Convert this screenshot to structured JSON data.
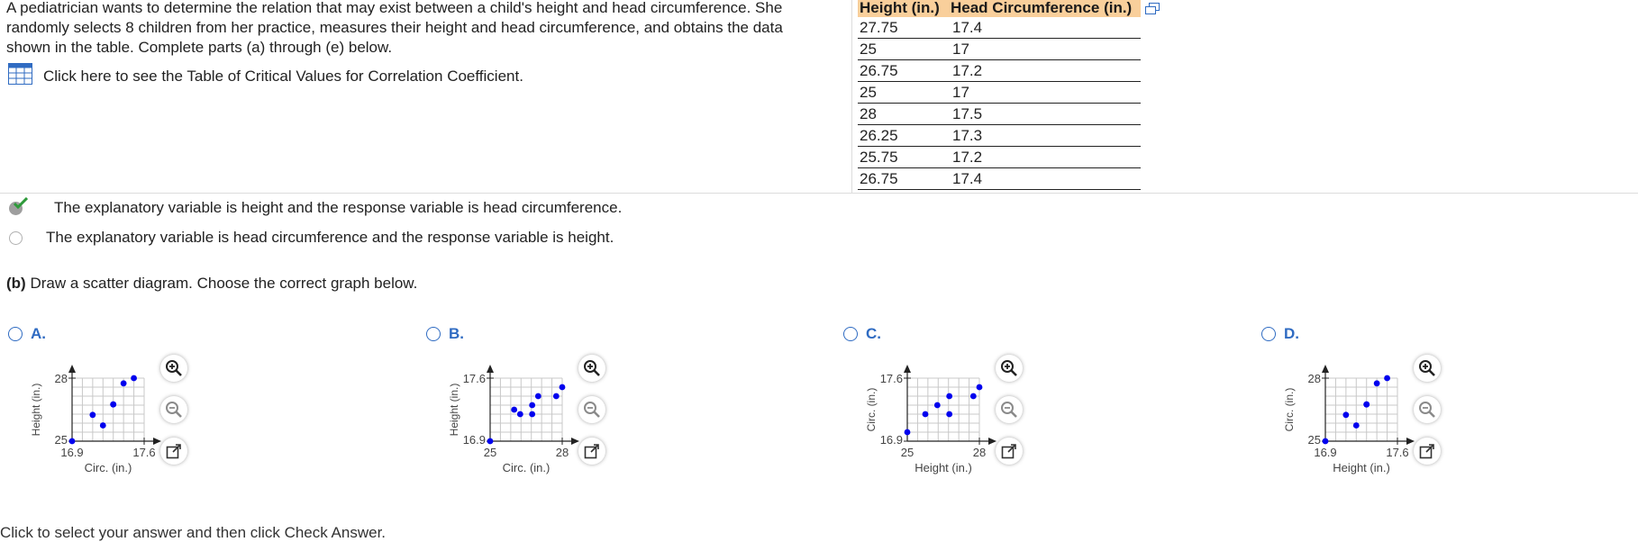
{
  "intro": {
    "line1": "A pediatrician wants to determine the relation that may exist between a child's height and head circumference. She",
    "line2": "randomly selects 8 children from her practice, measures their height and head circumference, and obtains the data",
    "line3": "shown in the table. Complete parts (a) through (e) below."
  },
  "link": {
    "text": "Click here to see the Table of Critical Values for Correlation Coefficient.",
    "icon": "table-grid-icon"
  },
  "table": {
    "headers": [
      "Height (in.)",
      "Head Circumference (in.)"
    ],
    "rows": [
      [
        "27.75",
        "17.4"
      ],
      [
        "25",
        "17"
      ],
      [
        "26.75",
        "17.2"
      ],
      [
        "25",
        "17"
      ],
      [
        "28",
        "17.5"
      ],
      [
        "26.25",
        "17.3"
      ],
      [
        "25.75",
        "17.2"
      ],
      [
        "26.75",
        "17.4"
      ]
    ]
  },
  "options_a": [
    {
      "text": "The explanatory variable is height and the response variable is head circumference.",
      "selected": true
    },
    {
      "text": "The explanatory variable is head circumference and the response variable is height.",
      "selected": false
    }
  ],
  "part_b": {
    "label": "(b)",
    "text": " Draw a scatter diagram. Choose the correct graph below."
  },
  "choices": [
    {
      "letter": "A.",
      "xlabel": "Circ. (in.)",
      "ylabel": "Height (in.)",
      "xticks": [
        "16.9",
        "17.6"
      ],
      "yticks": [
        "25",
        "28"
      ],
      "points": [
        [
          16.9,
          25
        ],
        [
          17.2,
          25.75
        ],
        [
          17.1,
          26.25
        ],
        [
          17.3,
          26.75
        ],
        [
          17.3,
          26.75
        ],
        [
          17.4,
          27.75
        ],
        [
          17.5,
          28
        ]
      ]
    },
    {
      "letter": "B.",
      "xlabel": "Circ. (in.)",
      "ylabel": "Height (in.)",
      "xticks": [
        "25",
        "28"
      ],
      "yticks": [
        "16.9",
        "17.6"
      ],
      "points": [
        [
          25,
          16.9
        ],
        [
          26.25,
          17.2
        ],
        [
          26.75,
          17.3
        ],
        [
          26,
          17.25
        ],
        [
          26.75,
          17.2
        ],
        [
          27,
          17.4
        ],
        [
          27.75,
          17.4
        ],
        [
          28,
          17.5
        ]
      ]
    },
    {
      "letter": "C.",
      "xlabel": "Height (in.)",
      "ylabel": "Circ. (in.)",
      "xticks": [
        "25",
        "28"
      ],
      "yticks": [
        "16.9",
        "17.6"
      ],
      "points": [
        [
          25,
          17
        ],
        [
          25.75,
          17.2
        ],
        [
          26.25,
          17.3
        ],
        [
          26.75,
          17.2
        ],
        [
          26.75,
          17.4
        ],
        [
          27.75,
          17.4
        ],
        [
          28,
          17.5
        ]
      ]
    },
    {
      "letter": "D.",
      "xlabel": "Height (in.)",
      "ylabel": "Circ. (in.)",
      "xticks": [
        "16.9",
        "17.6"
      ],
      "yticks": [
        "25",
        "28"
      ],
      "points": [
        [
          16.9,
          25
        ],
        [
          17.2,
          25.75
        ],
        [
          17.1,
          26.25
        ],
        [
          17.3,
          26.75
        ],
        [
          17.3,
          26.75
        ],
        [
          17.4,
          27.75
        ],
        [
          17.5,
          28
        ]
      ]
    }
  ],
  "tools": {
    "zoom_in": "zoom-in-icon",
    "zoom_out": "zoom-out-icon",
    "popout": "popout-icon"
  },
  "colors": {
    "header_bg": "#f9cf9b",
    "link_blue": "#2f6bc2",
    "point": "#0000ee",
    "check_green": "#2e9a3a"
  },
  "footer": {
    "text": "Click to select your answer and then click Check Answer."
  }
}
